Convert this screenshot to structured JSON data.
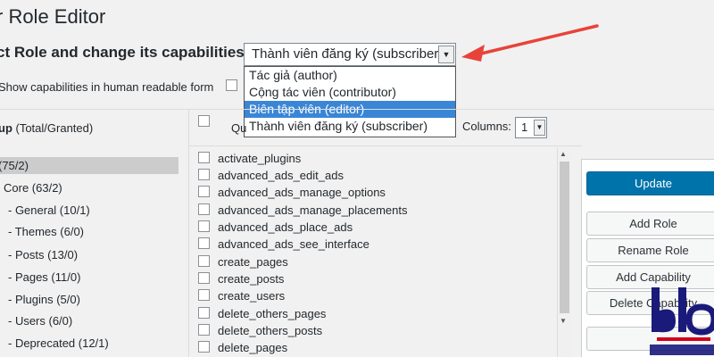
{
  "page": {
    "title": "r Role Editor"
  },
  "role_select": {
    "label": "ct Role and change its capabilities:",
    "selected": "Thành viên đăng ký (subscriber)",
    "arrow": "▼",
    "options": [
      "Tác giả (author)",
      "Cộng tác viên (contributor)",
      "Biên tập viên (editor)",
      "Thành viên đăng ký (subscriber)"
    ]
  },
  "human_readable": {
    "label": "Show capabilities in human readable form"
  },
  "groups": {
    "header_bold": "up",
    "header_rest": " (Total/Granted)",
    "items": [
      "(75/2)",
      "Core (63/2)",
      "- General (10/1)",
      "- Themes (6/0)",
      "- Posts (13/0)",
      "- Pages (11/0)",
      "- Plugins (5/0)",
      "- Users (6/0)",
      "- Deprecated (12/1)"
    ]
  },
  "toolbar": {
    "quick_label": "Qu",
    "columns_label": "Columns:",
    "columns_value": "1",
    "arrow": "▼"
  },
  "capabilities": [
    "activate_plugins",
    "advanced_ads_edit_ads",
    "advanced_ads_manage_options",
    "advanced_ads_manage_placements",
    "advanced_ads_place_ads",
    "advanced_ads_see_interface",
    "create_pages",
    "create_posts",
    "create_users",
    "delete_others_pages",
    "delete_others_posts",
    "delete_pages"
  ],
  "scrollbar": {
    "up": "▲",
    "down": "▼"
  },
  "actions": {
    "update": "Update",
    "add_role": "Add Role",
    "rename_role": "Rename Role",
    "add_capability": "Add Capability",
    "delete_capability": "Delete Capability"
  },
  "colors": {
    "accent": "#e8433a",
    "primary_button": "#0073aa",
    "selected_option": "#3a86d6"
  }
}
